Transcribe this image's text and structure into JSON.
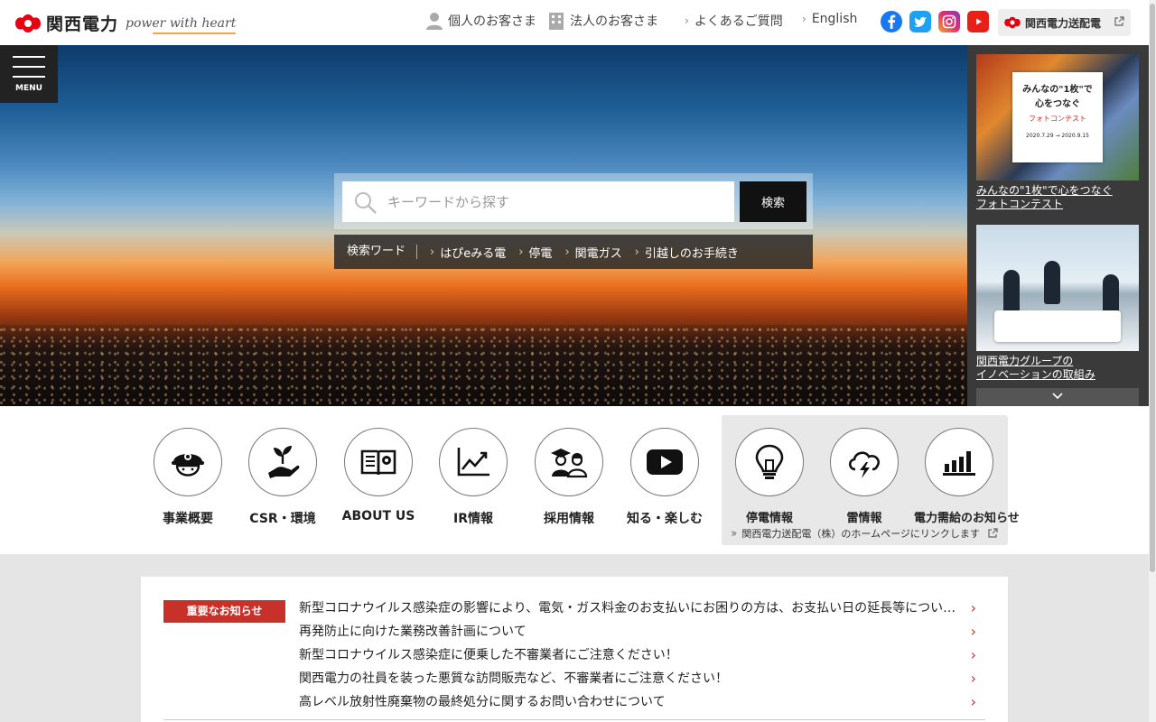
{
  "header": {
    "logo_text": "関西電力",
    "tagline": "power with heart",
    "nav": {
      "personal": "個人のお客さま",
      "corporate": "法人のお客さま",
      "faq": "よくあるご質問",
      "english": "English"
    },
    "social": [
      "facebook-icon",
      "twitter-icon",
      "instagram-icon",
      "youtube-icon"
    ],
    "td_button": "関西電力送配電"
  },
  "menu": {
    "label": "MENU"
  },
  "search": {
    "placeholder": "キーワードから探す",
    "button": "検索",
    "keyword_label": "検索ワード",
    "keywords": [
      "はぴeみる電",
      "停電",
      "関電ガス",
      "引越しのお手続き"
    ]
  },
  "side_banners": [
    {
      "caption_line1": "みんなの\"1枚\"で心をつなぐ",
      "caption_line2": "フォトコンテスト",
      "poster_title1": "みんなの\"1枚\"で",
      "poster_title2": "心をつなぐ",
      "poster_sub": "フォトコンテスト",
      "poster_dates": "2020.7.29 → 2020.9.15"
    },
    {
      "caption_line1": "関西電力グループの",
      "caption_line2": "イノベーションの取組み"
    }
  ],
  "icon_nav": [
    {
      "label": "事業概要",
      "icon": "worker-helmet-icon"
    },
    {
      "label": "CSR・環境",
      "icon": "sprout-hand-icon"
    },
    {
      "label": "ABOUT US",
      "icon": "book-icon"
    },
    {
      "label": "IR情報",
      "icon": "line-chart-icon"
    },
    {
      "label": "採用情報",
      "icon": "graduates-icon"
    },
    {
      "label": "知る・楽しむ",
      "icon": "play-icon"
    }
  ],
  "td_nav": {
    "items": [
      {
        "label": "停電情報",
        "icon": "lightbulb-icon"
      },
      {
        "label": "雷情報",
        "icon": "thunder-cloud-icon"
      },
      {
        "label": "電力需給のお知らせ",
        "icon": "bar-signal-icon"
      }
    ],
    "link_text": "関西電力送配電（株）のホームページにリンクします"
  },
  "notices": {
    "tag": "重要なお知らせ",
    "items": [
      "新型コロナウイルス感染症の影響により、電気・ガス料金のお支払いにお困りの方は、お支払い日の延長等につい…",
      "再発防止に向けた業務改善計画について",
      "新型コロナウイルス感染症に便乗した不審業者にご注意ください！",
      "関西電力の社員を装った悪質な訪問販売など、不審業者にご注意ください！",
      "高レベル放射性廃棄物の最終処分に関するお問い合わせについて"
    ]
  },
  "colors": {
    "brand_red": "#e60012",
    "notice_red": "#c8312a",
    "dark": "#111111"
  }
}
